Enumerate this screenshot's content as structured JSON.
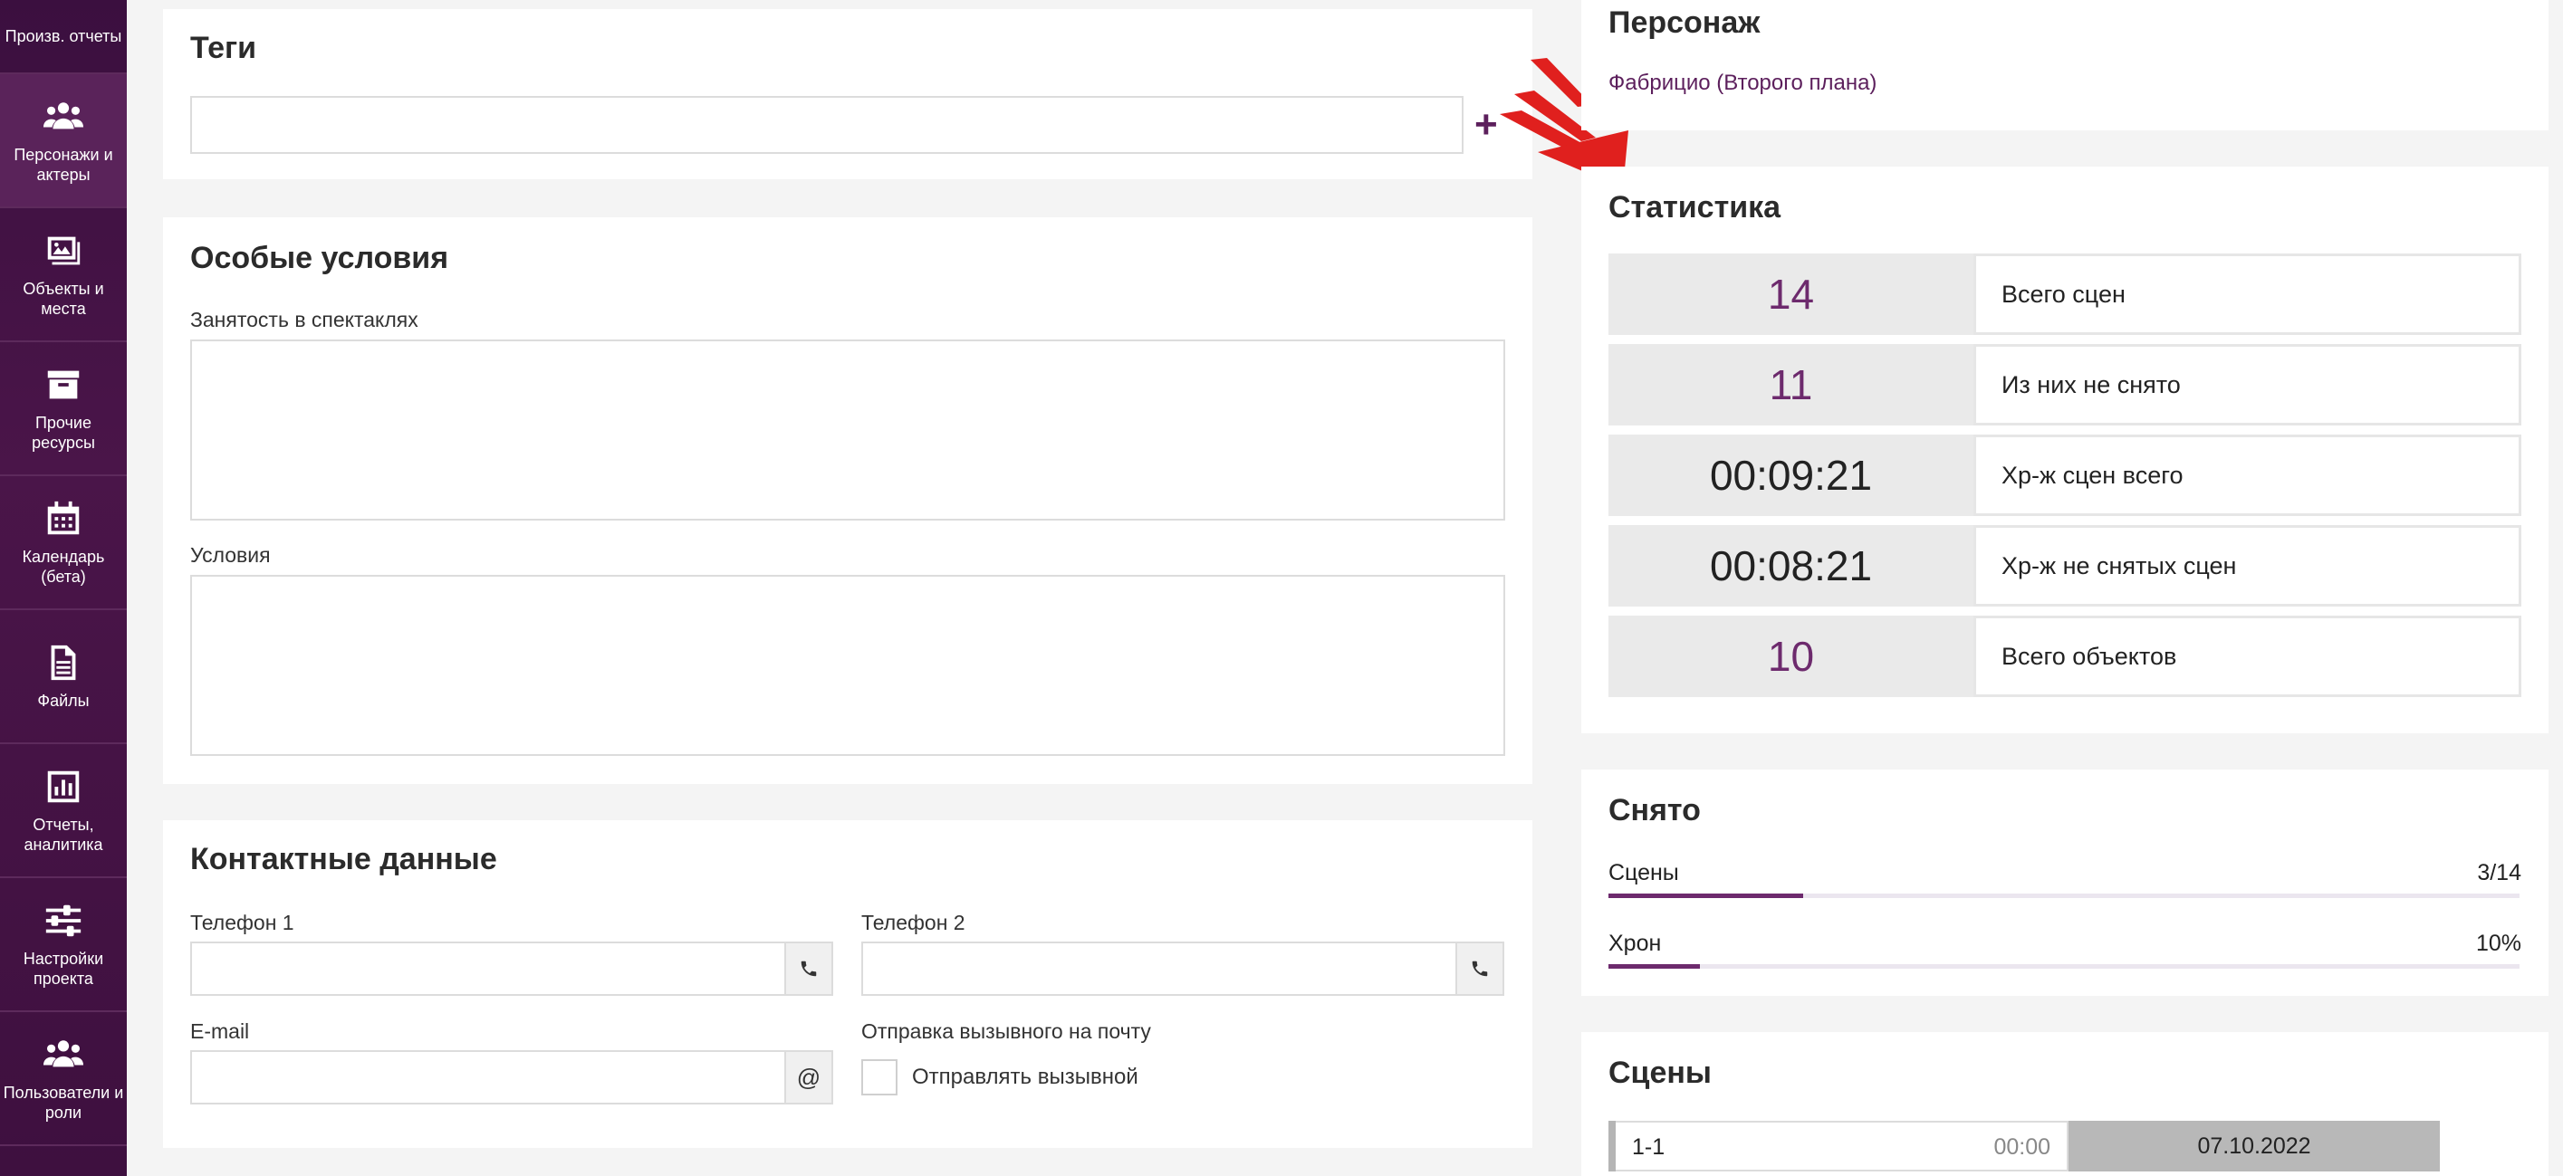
{
  "sidebar": {
    "items": [
      {
        "label": "Произв. отчеты",
        "icon": "report-icon"
      },
      {
        "label": "Персонажи и актеры",
        "icon": "people-icon"
      },
      {
        "label": "Объекты и места",
        "icon": "image-icon"
      },
      {
        "label": "Прочие ресурсы",
        "icon": "archive-icon"
      },
      {
        "label": "Календарь (бета)",
        "icon": "calendar-icon"
      },
      {
        "label": "Файлы",
        "icon": "file-icon"
      },
      {
        "label": "Отчеты, аналитика",
        "icon": "bar-chart-icon"
      },
      {
        "label": "Настройки проекта",
        "icon": "sliders-icon"
      },
      {
        "label": "Пользователи и роли",
        "icon": "users-icon"
      }
    ]
  },
  "tags": {
    "title": "Теги",
    "value": "",
    "add_label": "+"
  },
  "special_conditions": {
    "title": "Особые условия",
    "employment_label": "Занятость в спектаклях",
    "employment_value": "",
    "conditions_label": "Условия",
    "conditions_value": ""
  },
  "contacts": {
    "title": "Контактные данные",
    "phone1_label": "Телефон 1",
    "phone1_value": "",
    "phone2_label": "Телефон 2",
    "phone2_value": "",
    "email_label": "E-mail",
    "email_value": "",
    "email_addon": "@",
    "callsheet_label": "Отправка вызывного на почту",
    "callsheet_checkbox_label": "Отправлять вызывной",
    "callsheet_checked": false
  },
  "character": {
    "title": "Персонаж",
    "name": "Фабрицио (Второго плана)"
  },
  "statistics": {
    "title": "Статистика",
    "rows": [
      {
        "value": "14",
        "label": "Всего сцен",
        "purple": true
      },
      {
        "value": "11",
        "label": "Из них не снято",
        "purple": true
      },
      {
        "value": "00:09:21",
        "label": "Хр-ж сцен всего",
        "purple": false
      },
      {
        "value": "00:08:21",
        "label": "Хр-ж не снятых сцен",
        "purple": false
      },
      {
        "value": "10",
        "label": "Всего объектов",
        "purple": true
      }
    ]
  },
  "shot": {
    "title": "Снято",
    "scenes_label": "Сцены",
    "scenes_value": "3/14",
    "scenes_fraction": 0.214,
    "chron_label": "Хрон",
    "chron_value": "10%",
    "chron_fraction": 0.1
  },
  "scenes": {
    "title": "Сцены",
    "rows": [
      {
        "id": "1-1",
        "time": "00:00",
        "date": "07.10.2022"
      }
    ]
  },
  "colors": {
    "accent": "#6d2a6d",
    "sidebar": "#3b0f3f",
    "decor_arrow": "#e0201e"
  }
}
